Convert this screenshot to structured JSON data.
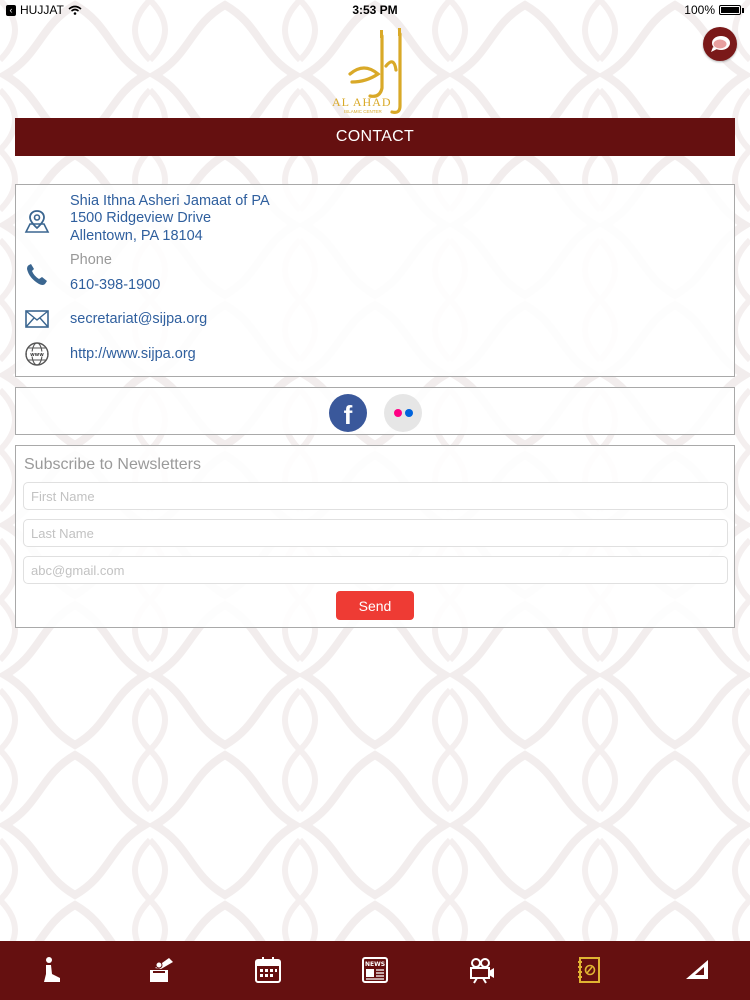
{
  "status_bar": {
    "carrier": "HUJJAT",
    "time": "3:53 PM",
    "battery": "100%"
  },
  "header": {
    "logo_text": "AL AHAD",
    "logo_subtext": "ISLAMIC CENTER",
    "page_title": "CONTACT"
  },
  "contact": {
    "org_name": "Shia Ithna Asheri Jamaat of PA",
    "address_line1": "1500 Ridgeview Drive",
    "address_line2": "Allentown, PA 18104",
    "phone_label": "Phone",
    "phone": "610-398-1900",
    "email": "secretariat@sijpa.org",
    "website": "http://www.sijpa.org"
  },
  "social": {
    "facebook_glyph": "f",
    "icons": [
      "facebook-icon",
      "flickr-icon"
    ]
  },
  "newsletter": {
    "title": "Subscribe to Newsletters",
    "first_name_placeholder": "First Name",
    "last_name_placeholder": "Last Name",
    "email_placeholder": "abc@gmail.com",
    "send_label": "Send"
  },
  "tabbar": {
    "tabs": [
      "prayer-icon",
      "donation-icon",
      "calendar-icon",
      "news-icon",
      "video-icon",
      "contact-book-icon",
      "more-icon"
    ],
    "active_tab": "contact-book-icon",
    "news_glyph": "NEWS"
  },
  "colors": {
    "primary": "#651010",
    "link": "#2f5f9e",
    "send_button": "#ee3b34",
    "active_tab": "#e0b432"
  }
}
